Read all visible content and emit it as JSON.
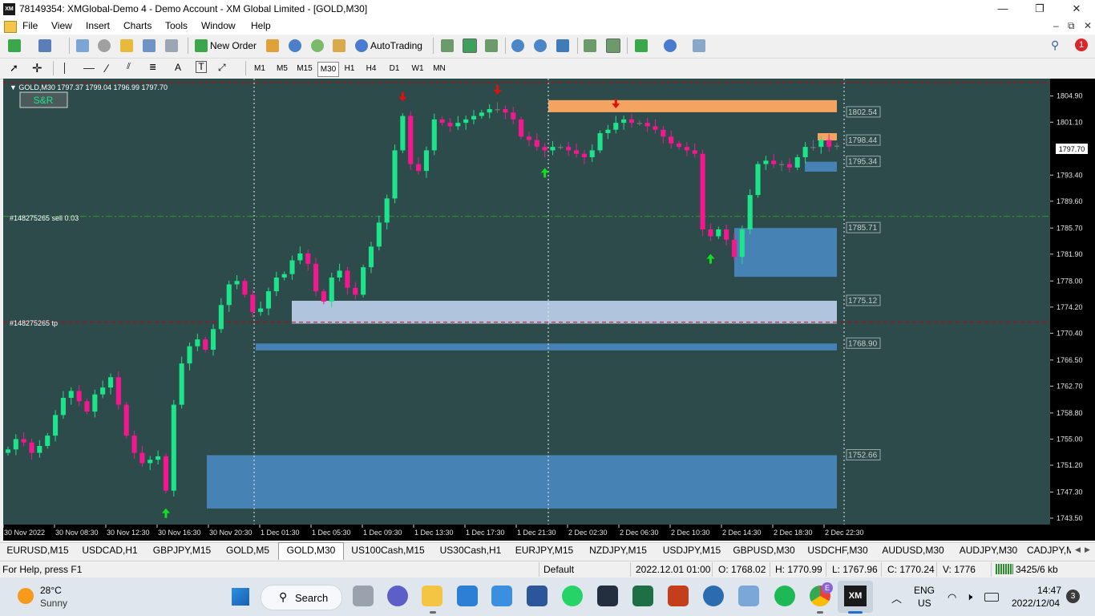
{
  "window": {
    "title": "78149354: XMGlobal-Demo 4 - Demo Account - XM Global Limited - [GOLD,M30]",
    "logo_text": "XM",
    "minimize": "—",
    "maximize": "❐",
    "close": "✕"
  },
  "menu": {
    "items": [
      "File",
      "View",
      "Insert",
      "Charts",
      "Tools",
      "Window",
      "Help"
    ],
    "mdi": [
      "–",
      "⧉",
      "✕"
    ]
  },
  "toolbar": {
    "new_order": "New Order",
    "autotrading": "AutoTrading",
    "notification_count": "1"
  },
  "timeframes": [
    "M1",
    "M5",
    "M15",
    "M30",
    "H1",
    "H4",
    "D1",
    "W1",
    "MN"
  ],
  "active_timeframe": "M30",
  "chart": {
    "header": "▼ GOLD,M30  1797.37 1799.04 1796.99 1797.70",
    "sr_label": "S&R",
    "order_line_label": "#148275265 sell 0.03",
    "tp_line_label": "#148275265 tp",
    "current_price": "1797.70",
    "colors": {
      "background": "#2d4b4b",
      "bull": "#1de38a",
      "bear": "#f5178f",
      "neutral": "#737373",
      "demand_zone": "#4682b4",
      "light_zone": "#b0c4de",
      "supply_zone": "#f4a460"
    },
    "price_axis": [
      "1804.90",
      "1801.10",
      "1797.70",
      "1793.40",
      "1789.60",
      "1785.70",
      "1781.90",
      "1778.00",
      "1774.20",
      "1770.40",
      "1766.50",
      "1762.70",
      "1758.80",
      "1755.00",
      "1751.20",
      "1747.30",
      "1743.50"
    ],
    "zone_labels": [
      "1802.54",
      "1798.44",
      "1795.34",
      "1785.71",
      "1775.12",
      "1768.90",
      "1752.66"
    ],
    "time_axis": [
      "30 Nov 2022",
      "30 Nov 08:30",
      "30 Nov 12:30",
      "30 Nov 16:30",
      "30 Nov 20:30",
      "1 Dec 01:30",
      "1 Dec 05:30",
      "1 Dec 09:30",
      "1 Dec 13:30",
      "1 Dec 17:30",
      "1 Dec 21:30",
      "2 Dec 02:30",
      "2 Dec 06:30",
      "2 Dec 10:30",
      "2 Dec 14:30",
      "2 Dec 18:30",
      "2 Dec 22:30"
    ]
  },
  "chart_data": {
    "type": "candlestick",
    "symbol": "GOLD",
    "timeframe": "M30",
    "close_path": [
      1753.5,
      1755.0,
      1754.5,
      1753.0,
      1754.0,
      1755.5,
      1758.5,
      1761.0,
      1762.0,
      1760.5,
      1759.0,
      1761.5,
      1762.5,
      1764.0,
      1760.0,
      1755.5,
      1753.0,
      1751.5,
      1752.0,
      1752.5,
      1747.5,
      1760.0,
      1766.0,
      1768.5,
      1769.5,
      1768.0,
      1771.0,
      1774.5,
      1777.5,
      1778.0,
      1776.0,
      1773.5,
      1774.0,
      1776.5,
      1778.5,
      1779.0,
      1781.0,
      1782.0,
      1780.5,
      1776.5,
      1775.0,
      1778.5,
      1779.5,
      1777.0,
      1776.0,
      1780.0,
      1783.0,
      1786.5,
      1790.0,
      1797.0,
      1802.0,
      1795.0,
      1794.0,
      1797.0,
      1801.5,
      1801.0,
      1800.5,
      1801.0,
      1801.5,
      1802.0,
      1802.5,
      1803.0,
      1803.0,
      1802.5,
      1801.5,
      1799.0,
      1798.5,
      1797.5,
      1797.0,
      1797.5,
      1797.5,
      1797.0,
      1796.5,
      1796.0,
      1797.0,
      1799.5,
      1800.0,
      1801.0,
      1801.5,
      1801.0,
      1801.0,
      1800.5,
      1800.0,
      1799.0,
      1798.0,
      1797.5,
      1797.0,
      1796.5,
      1785.5,
      1784.5,
      1785.5,
      1784.0,
      1781.5,
      1785.5,
      1790.5,
      1795.0,
      1795.5,
      1795.0,
      1795.0,
      1794.5,
      1796.0,
      1797.5,
      1797.5,
      1798.5,
      1797.5,
      1797.7
    ],
    "x_range": [
      "30 Nov 2022",
      "2 Dec 22:30"
    ],
    "ylim": [
      1743.5,
      1806.5
    ],
    "zones": [
      {
        "type": "supply",
        "low": 1802.54,
        "high": 1804.3,
        "label": "1802.54"
      },
      {
        "type": "supply",
        "low": 1798.44,
        "high": 1799.5,
        "label": "1798.44"
      },
      {
        "type": "demand",
        "low": 1793.9,
        "high": 1795.34,
        "label": "1795.34"
      },
      {
        "type": "demand",
        "low": 1778.6,
        "high": 1785.71,
        "label": "1785.71"
      },
      {
        "type": "demand-light",
        "low": 1771.8,
        "high": 1775.12,
        "label": "1775.12"
      },
      {
        "type": "demand",
        "low": 1767.9,
        "high": 1768.9,
        "label": "1768.90"
      },
      {
        "type": "demand",
        "low": 1744.9,
        "high": 1752.66,
        "label": "1752.66"
      }
    ],
    "lines": [
      {
        "name": "#148275265 sell 0.03",
        "price": 1787.4,
        "style": "dash-dot",
        "color": "#2ea02e"
      },
      {
        "name": "#148275265 tp",
        "price": 1772.0,
        "style": "dashed",
        "color": "#cc0000"
      }
    ],
    "signals": [
      {
        "type": "up",
        "bar": 20
      },
      {
        "type": "down",
        "bar": 50
      },
      {
        "type": "down",
        "bar": 62
      },
      {
        "type": "up",
        "bar": 68
      },
      {
        "type": "down",
        "bar": 77
      },
      {
        "type": "up",
        "bar": 89
      }
    ],
    "grid": false
  },
  "tabs": {
    "items": [
      "EURUSD,M15",
      "USDCAD,H1",
      "GBPJPY,M15",
      "GOLD,M5",
      "GOLD,M30",
      "US100Cash,M15",
      "US30Cash,H1",
      "EURJPY,M15",
      "NZDJPY,M15",
      "USDJPY,M15",
      "GBPUSD,M30",
      "USDCHF,M30",
      "AUDUSD,M30",
      "AUDJPY,M30",
      "CADJPY,M"
    ],
    "active": "GOLD,M30",
    "scroll_left": "◀",
    "scroll_right": "▶"
  },
  "status": {
    "help": "For Help, press F1",
    "profile": "Default",
    "datetime": "2022.12.01 01:00",
    "open": "O: 1768.02",
    "high": "H: 1770.99",
    "low": "L: 1767.96",
    "close": "C: 1770.24",
    "volume": "V: 1776",
    "traffic": "3425/6 kb"
  },
  "taskbar": {
    "weather_temp": "28°C",
    "weather_desc": "Sunny",
    "search": "Search",
    "lang_top": "ENG",
    "lang_bottom": "US",
    "time": "14:47",
    "date": "2022/12/04",
    "notifications": "3",
    "chrome_badge": "E"
  }
}
